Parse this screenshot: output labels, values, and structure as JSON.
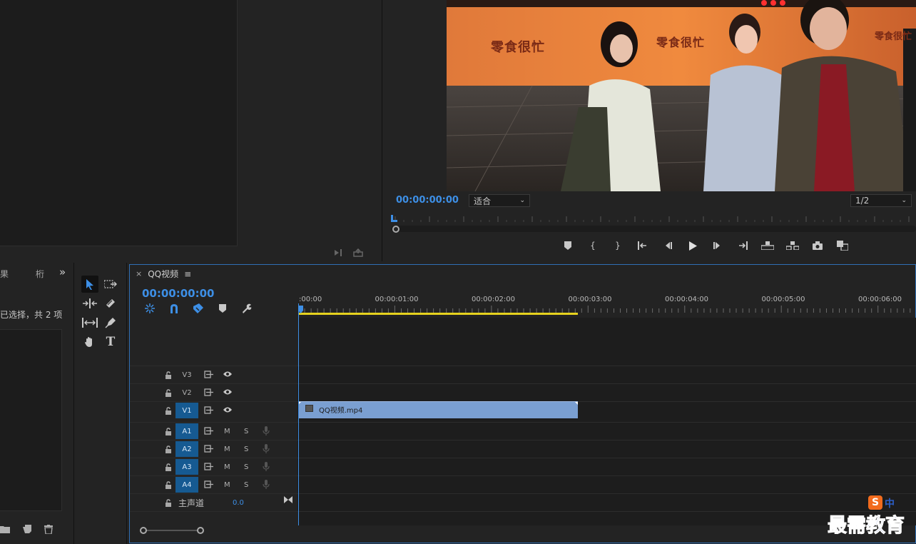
{
  "project": {
    "tab_partial_left": "果",
    "tab_partial_right": "桁",
    "more_label": "»",
    "status": "已选择，共 2 项"
  },
  "program": {
    "timecode": "00:00:00:00",
    "fit_label": "适合",
    "quality_label": "1/2",
    "video_sign_text": "零食很忙"
  },
  "timeline": {
    "close_label": "×",
    "sequence_name": "QQ视频",
    "menu_label": "≡",
    "timecode": "00:00:00:00",
    "ruler_labels": [
      ":00:00",
      "00:00:01:00",
      "00:00:02:00",
      "00:00:03:00",
      "00:00:04:00",
      "00:00:05:00",
      "00:00:06:00"
    ],
    "video_tracks": [
      {
        "name": "V3",
        "active": false
      },
      {
        "name": "V2",
        "active": false
      },
      {
        "name": "V1",
        "active": true
      }
    ],
    "audio_tracks": [
      {
        "name": "A1",
        "m": "M",
        "s": "S"
      },
      {
        "name": "A2",
        "m": "M",
        "s": "S"
      },
      {
        "name": "A3",
        "m": "M",
        "s": "S"
      },
      {
        "name": "A4",
        "m": "M",
        "s": "S"
      }
    ],
    "master": {
      "label": "主声道",
      "value": "0.0"
    },
    "clip": {
      "name": "QQ视频.mp4"
    }
  },
  "watermark": {
    "text": "最需教育",
    "badge": "S",
    "ime": "中"
  },
  "colors": {
    "accent_blue": "#3d8fe6",
    "track_active": "#165a92",
    "clip": "#7a9fd1",
    "work_area": "#e6d21e"
  }
}
